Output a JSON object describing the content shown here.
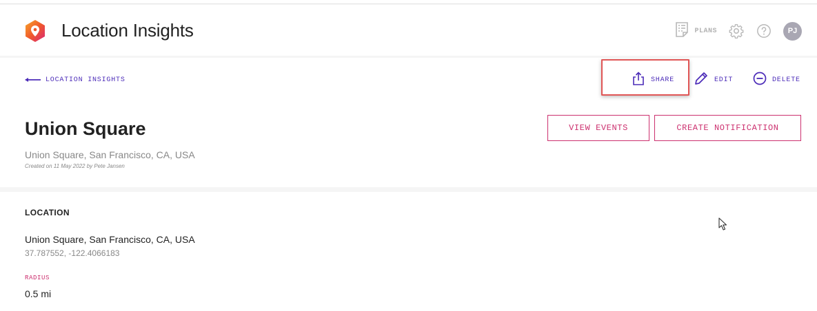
{
  "app": {
    "title": "Location Insights"
  },
  "header": {
    "plans_label": "PLANS",
    "avatar_initials": "PJ",
    "icons": [
      "plans-icon",
      "gear-icon",
      "help-icon"
    ]
  },
  "toolbar": {
    "back_label": "LOCATION INSIGHTS",
    "share_label": "SHARE",
    "edit_label": "EDIT",
    "delete_label": "DELETE"
  },
  "place": {
    "title": "Union Square",
    "address": "Union Square, San Francisco, CA, USA",
    "created": "Created on 11 May 2022 by Pete Jansen"
  },
  "buttons": {
    "view_events": "VIEW EVENTS",
    "create_notification": "CREATE NOTIFICATION"
  },
  "location": {
    "heading": "LOCATION",
    "address": "Union Square, San Francisco, CA, USA",
    "coordinates": "37.787552, -122.4066183",
    "radius_label": "RADIUS",
    "radius_value": "0.5 mi"
  },
  "colors": {
    "accent_purple": "#4b2bb8",
    "accent_pink": "#cc2f6e",
    "logo_orange": "#f0592b",
    "highlight_red": "#e05555"
  }
}
